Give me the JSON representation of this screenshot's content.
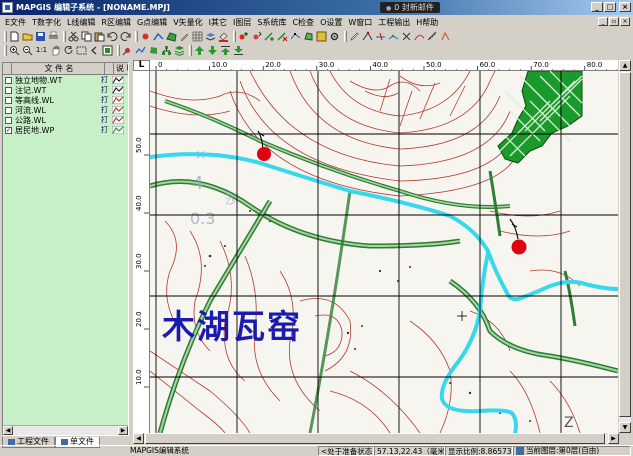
{
  "window": {
    "title": "MAPGIS 编辑子系统 - [NONAME.MPJ]",
    "notification": "0 封新邮件",
    "minimize": "_",
    "maximize": "□",
    "close": "×"
  },
  "menu": [
    "E文件",
    "T数字化",
    "L线编辑",
    "R区编辑",
    "G点编辑",
    "V矢量化",
    "I其它",
    "I图层",
    "S系统库",
    "C检查",
    "O设置",
    "W窗口",
    "工程输出",
    "H帮助"
  ],
  "layers": {
    "headers": [
      "",
      "文 件 名",
      "",
      "说 明"
    ],
    "items": [
      {
        "name": "独立地物.WT",
        "checked": false,
        "status": "打",
        "type": "point"
      },
      {
        "name": "注记.WT",
        "checked": false,
        "status": "打",
        "type": "point"
      },
      {
        "name": "等高线.WL",
        "checked": false,
        "status": "打",
        "type": "line"
      },
      {
        "name": "河流.WL",
        "checked": false,
        "status": "打",
        "type": "line"
      },
      {
        "name": "公路.WL",
        "checked": false,
        "status": "打",
        "type": "line"
      },
      {
        "name": "居民地.WP",
        "checked": true,
        "status": "打",
        "type": "area"
      }
    ],
    "tabs": [
      "工程文件",
      "单文件"
    ]
  },
  "ruler": {
    "corner": "L",
    "top_labels": [
      "0",
      "10.0",
      "20.0",
      "30.0",
      "40.0",
      "50.0",
      "60.0",
      "70.0",
      "80.0"
    ],
    "left_labels": [
      "50.0",
      "40.0",
      "30.0",
      "20.0",
      "10.0"
    ]
  },
  "map": {
    "label": "木湖瓦窑"
  },
  "status": {
    "system": "MAPGIS编辑系统",
    "state": "<处于准备状态>",
    "coords": "57.13,22.43（毫米）",
    "scale": "显示比例:8.865732",
    "layer": "当前图层:第0层(自由)"
  },
  "colors": {
    "title_start": "#0a246a",
    "panel_bg": "#c8f0c8",
    "river": "#38d8ec",
    "road_outer": "#2e7d32",
    "road_inner": "#a5d6a7",
    "contour": "#b03a2e",
    "settlement": "#1a9a2a",
    "marker": "#e00010",
    "label": "#1a1ab0"
  }
}
